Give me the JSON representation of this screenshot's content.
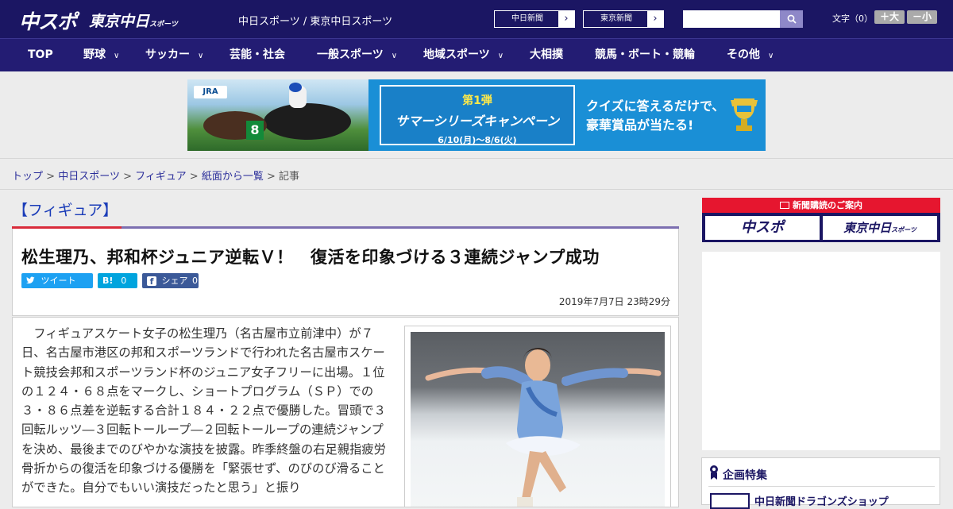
{
  "header": {
    "logo_a": "中スポ",
    "logo_b": "東京中日",
    "logo_b_small": "スポーツ",
    "tagline": "中日スポーツ / 東京中日スポーツ",
    "links": [
      {
        "label": "中日新聞"
      },
      {
        "label": "東京新聞"
      }
    ],
    "link_arrow": "›",
    "search_placeholder": "",
    "font_size_label": "文字（0）",
    "font_bigger": "＋大",
    "font_smaller": "－小"
  },
  "nav": {
    "items": [
      {
        "label": "TOP",
        "dropdown": false
      },
      {
        "label": "野球",
        "dropdown": true
      },
      {
        "label": "サッカー",
        "dropdown": true
      },
      {
        "label": "芸能・社会",
        "dropdown": false
      },
      {
        "label": "一般スポーツ",
        "dropdown": true
      },
      {
        "label": "地域スポーツ",
        "dropdown": true
      },
      {
        "label": "大相撲",
        "dropdown": false
      },
      {
        "label": "競馬・ボート・競輪",
        "dropdown": false
      },
      {
        "label": "その他",
        "dropdown": true
      }
    ],
    "chevron": "∨"
  },
  "banner": {
    "jra": "JRA",
    "campaign_title": "第1弾",
    "campaign_main": "サマーシリーズキャンペーン",
    "campaign_dates": "6/10(月)～8/6(火)",
    "quiz_line1": "クイズに答えるだけで、",
    "quiz_line2": "豪華賞品が当たる!",
    "colors": {
      "bg": "#1a8fd6",
      "accent": "#ffe94a"
    }
  },
  "breadcrumb": {
    "items": [
      "トップ",
      "中日スポーツ",
      "フィギュア",
      "紙面から一覧"
    ],
    "current": "記事",
    "separator": ">"
  },
  "article": {
    "category": "【フィギュア】",
    "headline": "松生理乃、邦和杯ジュニア逆転Ｖ！　復活を印象づける３連続ジャンプ成功",
    "share": {
      "tweet": "ツイート",
      "hatena": "B!",
      "hatena_count": "0",
      "facebook": "シェア",
      "facebook_count": "0"
    },
    "date": "2019年7月7日 23時29分",
    "body": "　フィギュアスケート女子の松生理乃（名古屋市立前津中）が７日、名古屋市港区の邦和スポーツランドで行われた名古屋市スケート競技会邦和スポーツランド杯のジュニア女子フリーに出場。１位の１２４・６８点をマークし、ショートプログラム（ＳＰ）での３・８６点差を逆転する合計１８４・２２点で優勝した。冒頭で３回転ルッツ―３回転トーループ―２回転トーループの連続ジャンプを決め、最後までのびやかな演技を披露。昨季終盤の右足親指疲労骨折からの復活を印象づける優勝を「緊張せず、のびのび滑ることができた。自分でもいい演技だったと思う」と振り"
  },
  "sidebar": {
    "subscribe_title": "新聞購読のご案内",
    "subscribe_a": "中スポ",
    "subscribe_b": "東京中日",
    "subscribe_b_small": "スポーツ",
    "feature_title": "企画特集",
    "feature_item": "中日新聞ドラゴンズショップ"
  },
  "colors": {
    "brand_navy": "#1b1663",
    "nav_bg": "#231c73",
    "accent_red": "#e6162f",
    "link_blue": "#2a2d9a",
    "twitter": "#1da1f2",
    "hatena": "#00a4de",
    "facebook": "#3b5998"
  }
}
